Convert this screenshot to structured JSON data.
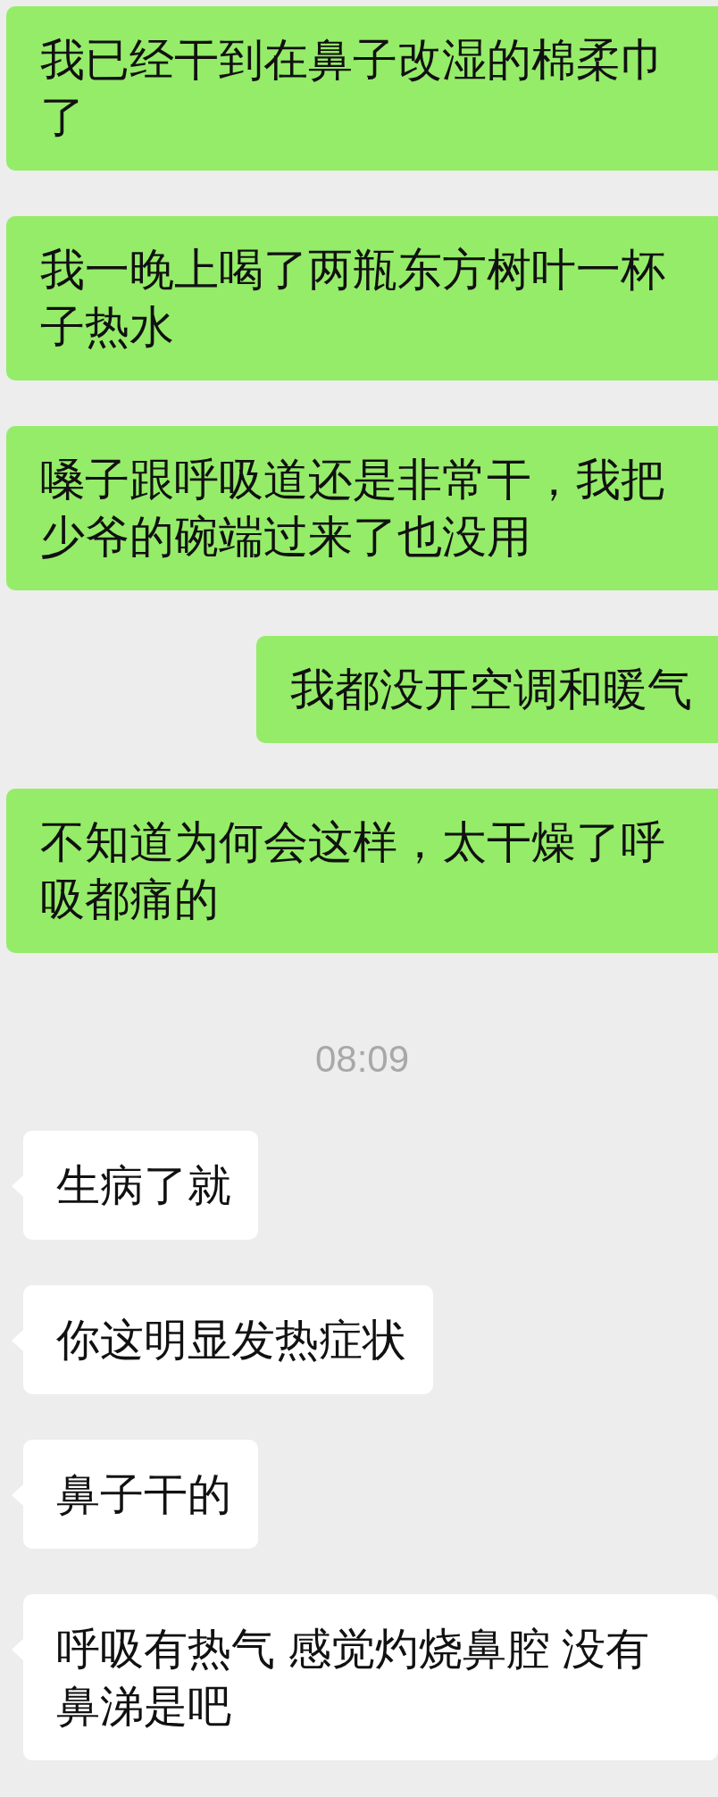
{
  "messages": [
    {
      "kind": "sent",
      "text": "我已经干到在鼻子改湿的棉柔巾了"
    },
    {
      "kind": "sent",
      "text": "我一晚上喝了两瓶东方树叶一杯子热水"
    },
    {
      "kind": "sent",
      "text": "嗓子跟呼吸道还是非常干，我把少爷的碗端过来了也没用"
    },
    {
      "kind": "sent",
      "text": "我都没开空调和暖气"
    },
    {
      "kind": "sent",
      "text": "不知道为何会这样，太干燥了呼吸都痛的"
    },
    {
      "kind": "time",
      "text": "08:09"
    },
    {
      "kind": "received",
      "text": "生病了就"
    },
    {
      "kind": "received",
      "text": "你这明显发热症状"
    },
    {
      "kind": "received",
      "text": "鼻子干的"
    },
    {
      "kind": "received",
      "text": "呼吸有热气 感觉灼烧鼻腔 没有鼻涕是吧"
    }
  ]
}
